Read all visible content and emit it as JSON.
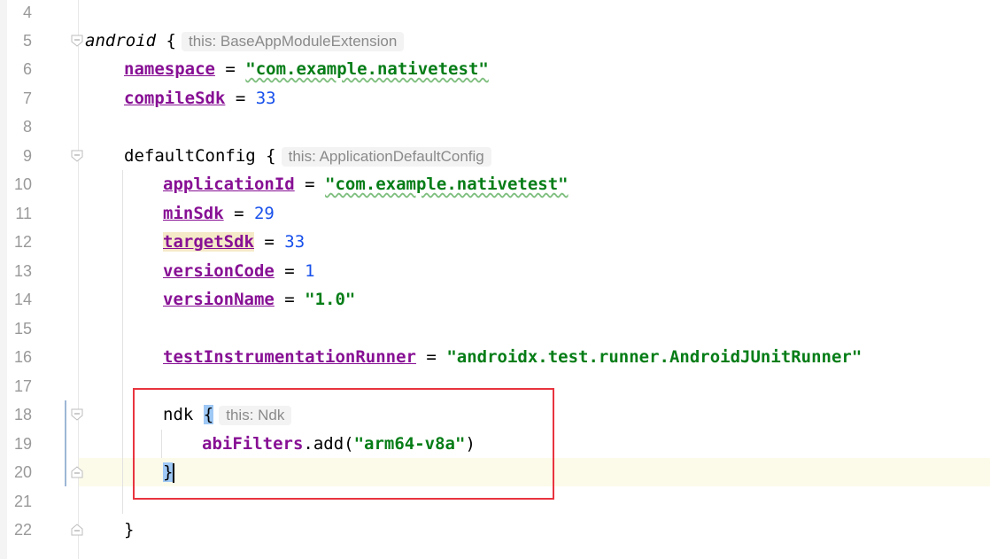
{
  "editor": {
    "line_numbers": [
      "4",
      "5",
      "6",
      "7",
      "8",
      "9",
      "10",
      "11",
      "12",
      "13",
      "14",
      "15",
      "16",
      "17",
      "18",
      "19",
      "20",
      "21",
      "22"
    ],
    "code": {
      "android": {
        "keyword": "android",
        "brace": "{",
        "hint": "this: BaseAppModuleExtension"
      },
      "namespace": {
        "name": "namespace",
        "op": " = ",
        "value": "\"com.example.nativetest\""
      },
      "compileSdk": {
        "name": "compileSdk",
        "op": " = ",
        "value": "33"
      },
      "defaultConfig": {
        "keyword": "defaultConfig",
        "brace": "{",
        "hint": "this: ApplicationDefaultConfig"
      },
      "applicationId": {
        "name": "applicationId",
        "op": " = ",
        "value": "\"com.example.nativetest\""
      },
      "minSdk": {
        "name": "minSdk",
        "op": " = ",
        "value": "29"
      },
      "targetSdk": {
        "name": "targetSdk",
        "op": " = ",
        "value": "33"
      },
      "versionCode": {
        "name": "versionCode",
        "op": " = ",
        "value": "1"
      },
      "versionName": {
        "name": "versionName",
        "op": " = ",
        "value": "\"1.0\""
      },
      "testRunner": {
        "name": "testInstrumentationRunner",
        "op": " = ",
        "value": "\"androidx.test.runner.AndroidJUnitRunner\""
      },
      "ndk": {
        "keyword": "ndk",
        "brace": "{",
        "hint": "this: Ndk"
      },
      "abiFilters": {
        "name": "abiFilters",
        "call": ".add(",
        "value": "\"arm64-v8a\"",
        "close": ")"
      },
      "ndk_close": "}",
      "default_close": "}"
    }
  },
  "colors": {
    "property": "#871094",
    "string": "#067d17",
    "number": "#1750eb",
    "highlight_box": "#e8343f",
    "caret_line": "#fcfae9"
  }
}
